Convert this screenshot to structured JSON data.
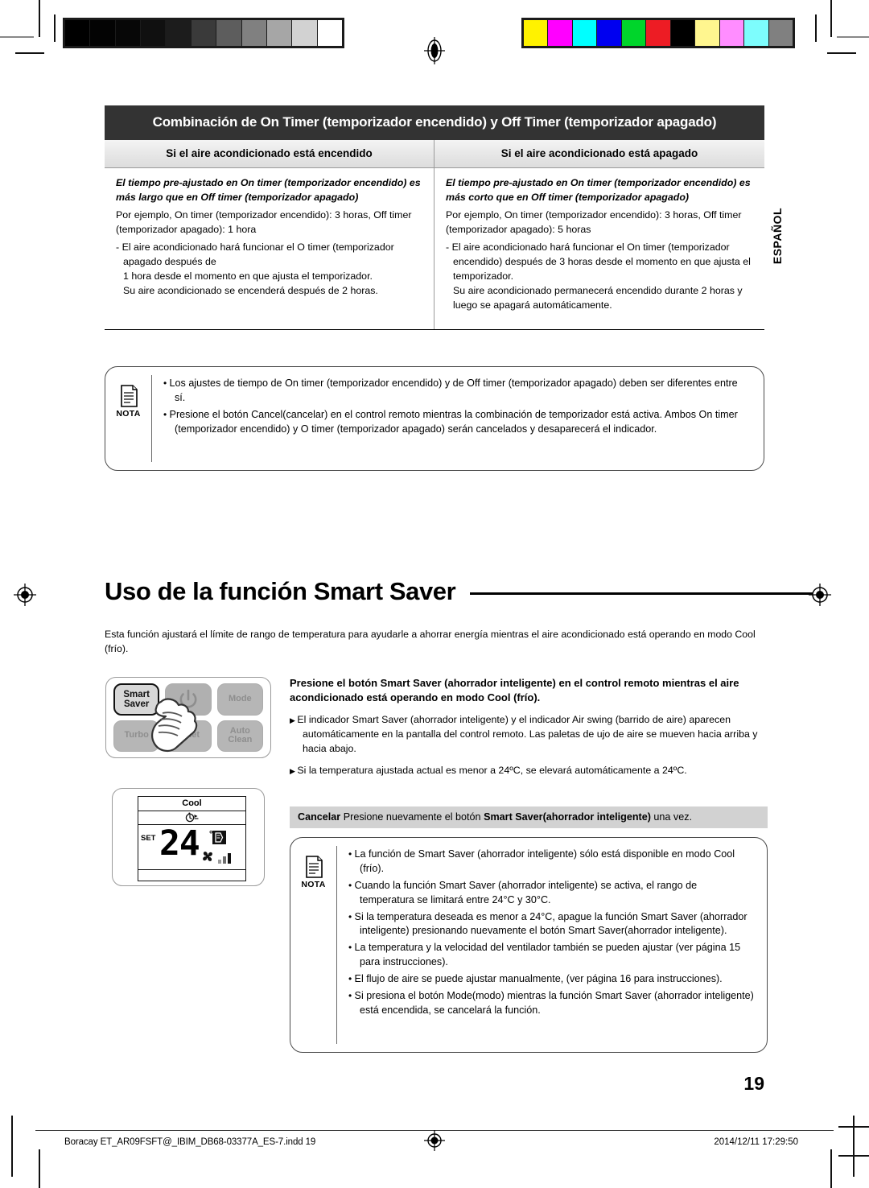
{
  "calibration": {
    "gray_ramp": [
      "#000000",
      "#030303",
      "#070707",
      "#101010",
      "#1c1c1c",
      "#3a3a3a",
      "#5d5d5d",
      "#808080",
      "#a6a6a6",
      "#d2d2d2",
      "#ffffff"
    ],
    "color_ramp": [
      "#fff200",
      "#ff00ff",
      "#00ffff",
      "#0000f0",
      "#00d52b",
      "#ed1c24",
      "#000000",
      "#fff68f",
      "#ff8dff",
      "#7dfdfd",
      "#808080"
    ]
  },
  "table": {
    "title": "Combinación de On Timer (temporizador encendido) y Off Timer (temporizador apagado)",
    "headers": [
      "Si el aire acondicionado está encendido",
      "Si el aire acondicionado está apagado"
    ],
    "cells": [
      {
        "emphasis": "El tiempo pre-ajustado en On timer (temporizador encendido) es más largo que en Off timer (temporizador apagado)",
        "example": "Por ejemplo, On timer (temporizador encendido): 3 horas, Off timer (temporizador apagado): 1 hora",
        "dash": "- El aire acondicionado hará funcionar el O  timer (temporizador apagado después de",
        "sub1": "1 hora desde el momento en que ajusta el temporizador.",
        "sub2": "Su aire acondicionado se encenderá después de 2 horas."
      },
      {
        "emphasis": "El tiempo pre-ajustado en On timer (temporizador encendido) es más corto que en Off timer (temporizador apagado)",
        "example": "Por ejemplo, On timer (temporizador encendido): 3 horas, Off timer (temporizador apagado): 5 horas",
        "dash": "- El aire acondicionado hará funcionar el On timer (temporizador encendido) después de 3 horas desde el momento en que ajusta el temporizador.",
        "sub1": "Su aire acondicionado permanecerá encendido durante 2 horas y luego se apagará automáticamente.",
        "sub2": ""
      }
    ]
  },
  "language_tab": "ESPAÑOL",
  "nota_top": {
    "label": "NOTA",
    "items": [
      "Los ajustes de tiempo de On timer (temporizador encendido) y de Off timer (temporizador apagado) deben ser diferentes entre sí.",
      "Presione el botón Cancel(cancelar) en el control remoto mientras la combinación de temporizador está activa. Ambos On timer (temporizador encendido) y O  timer (temporizador apagado) serán cancelados y desaparecerá el indicador."
    ]
  },
  "section": {
    "title": "Uso de la función Smart Saver",
    "intro": "Esta función ajustará el límite de rango de temperatura para ayudarle a ahorrar energía mientras el aire acondicionado está operando en modo Cool (frío)."
  },
  "remote": {
    "keys": [
      {
        "label": "Smart\nSaver",
        "state": "highlighted"
      },
      {
        "label": "",
        "state": "power"
      },
      {
        "label": "Mode",
        "state": "normal"
      },
      {
        "label": "Turbo",
        "state": "normal"
      },
      {
        "label": "Quiet",
        "state": "normal"
      },
      {
        "label": "Auto\nClean",
        "state": "normal"
      }
    ],
    "key_labels": {
      "smart_saver": "Smart Saver",
      "mode": "Mode",
      "turbo": "Turbo",
      "quiet": "Quiet",
      "auto_clean": "Auto Clean"
    },
    "lcd": {
      "mode": "Cool",
      "set_label": "SET",
      "temperature": "24",
      "degree": "°C"
    }
  },
  "instructions": {
    "lead": "Presione el botón Smart Saver (ahorrador inteligente) en el control remoto mientras el aire acondicionado está operando en modo Cool (frío).",
    "items": [
      "El indicador Smart Saver (ahorrador inteligente) y el indicador Air swing (barrido de aire) aparecen automáticamente en la pantalla del control remoto. Las paletas de  ujo de aire se mueven hacia arriba y hacia abajo.",
      "Si la temperatura ajustada actual es menor a 24ºC, se elevará automáticamente a 24ºC."
    ]
  },
  "cancel": {
    "label": "Cancelar",
    "text_before": "Presione nuevamente el botón ",
    "bold": "Smart Saver(ahorrador inteligente)",
    "text_after": " una vez."
  },
  "nota_bottom": {
    "label": "NOTA",
    "items": [
      "La función de Smart Saver (ahorrador inteligente) sólo está disponible en modo Cool (frío).",
      "Cuando la función Smart Saver (ahorrador inteligente) se activa, el rango de temperatura se limitará entre 24°C y 30°C.",
      "Si la temperatura deseada es menor a 24°C, apague la función Smart Saver (ahorrador inteligente) presionando nuevamente el botón Smart Saver(ahorrador inteligente).",
      "La temperatura y la velocidad del ventilador también se pueden ajustar (ver página 15 para instrucciones).",
      "El flujo de aire se puede ajustar manualmente, (ver página 16 para instrucciones).",
      "Si presiona el botón Mode(modo) mientras la función Smart Saver (ahorrador inteligente) está encendida, se cancelará la función."
    ]
  },
  "page_number": "19",
  "footer": {
    "left": "Boracay ET_AR09FSFT@_IBIM_DB68-03377A_ES-7.indd   19",
    "right": "2014/12/11   17:29:50"
  }
}
